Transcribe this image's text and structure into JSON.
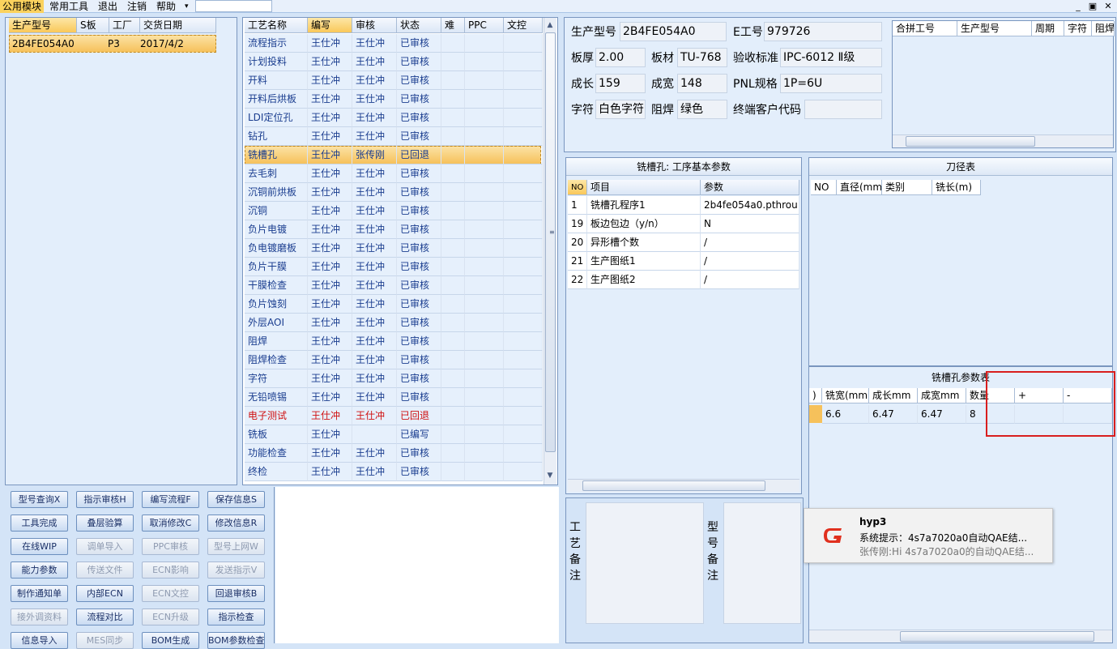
{
  "menu": {
    "items": [
      "公用模块",
      "常用工具",
      "退出",
      "注销",
      "帮助"
    ],
    "dropdown_arrow": "▾",
    "win_min": "_",
    "win_restore": "▣",
    "win_close": "✕"
  },
  "orders": {
    "headers": [
      "生产型号",
      "S板",
      "工厂",
      "交货日期"
    ],
    "rows": [
      {
        "model": "2B4FE054A0",
        "s": "",
        "factory": "P3",
        "date": "2017/4/2"
      }
    ]
  },
  "process": {
    "headers": [
      "工艺名称",
      "编写",
      "审核",
      "状态",
      "难",
      "PPC",
      "文控"
    ],
    "rows": [
      {
        "name": "流程指示",
        "writer": "王仕冲",
        "reviewer": "王仕冲",
        "status": "已审核"
      },
      {
        "name": "计划投料",
        "writer": "王仕冲",
        "reviewer": "王仕冲",
        "status": "已审核"
      },
      {
        "name": "开料",
        "writer": "王仕冲",
        "reviewer": "王仕冲",
        "status": "已审核"
      },
      {
        "name": "开料后烘板",
        "writer": "王仕冲",
        "reviewer": "王仕冲",
        "status": "已审核"
      },
      {
        "name": "LDI定位孔",
        "writer": "王仕冲",
        "reviewer": "王仕冲",
        "status": "已审核"
      },
      {
        "name": "钻孔",
        "writer": "王仕冲",
        "reviewer": "王仕冲",
        "status": "已审核"
      },
      {
        "name": "铣槽孔",
        "writer": "王仕冲",
        "reviewer": "张传刚",
        "status": "已回退"
      },
      {
        "name": "去毛刺",
        "writer": "王仕冲",
        "reviewer": "王仕冲",
        "status": "已审核"
      },
      {
        "name": "沉铜前烘板",
        "writer": "王仕冲",
        "reviewer": "王仕冲",
        "status": "已审核"
      },
      {
        "name": "沉铜",
        "writer": "王仕冲",
        "reviewer": "王仕冲",
        "status": "已审核"
      },
      {
        "name": "负片电镀",
        "writer": "王仕冲",
        "reviewer": "王仕冲",
        "status": "已审核"
      },
      {
        "name": "负电镀磨板",
        "writer": "王仕冲",
        "reviewer": "王仕冲",
        "status": "已审核"
      },
      {
        "name": "负片干膜",
        "writer": "王仕冲",
        "reviewer": "王仕冲",
        "status": "已审核"
      },
      {
        "name": "干膜检查",
        "writer": "王仕冲",
        "reviewer": "王仕冲",
        "status": "已审核"
      },
      {
        "name": "负片蚀刻",
        "writer": "王仕冲",
        "reviewer": "王仕冲",
        "status": "已审核"
      },
      {
        "name": "外层AOI",
        "writer": "王仕冲",
        "reviewer": "王仕冲",
        "status": "已审核"
      },
      {
        "name": "阻焊",
        "writer": "王仕冲",
        "reviewer": "王仕冲",
        "status": "已审核"
      },
      {
        "name": "阻焊检查",
        "writer": "王仕冲",
        "reviewer": "王仕冲",
        "status": "已审核"
      },
      {
        "name": "字符",
        "writer": "王仕冲",
        "reviewer": "王仕冲",
        "status": "已审核"
      },
      {
        "name": "无铅喷锡",
        "writer": "王仕冲",
        "reviewer": "王仕冲",
        "status": "已审核"
      },
      {
        "name": "电子测试",
        "writer": "王仕冲",
        "reviewer": "王仕冲",
        "status": "已回退"
      },
      {
        "name": "铣板",
        "writer": "王仕冲",
        "reviewer": "",
        "status": "已编写"
      },
      {
        "name": "功能检查",
        "writer": "王仕冲",
        "reviewer": "王仕冲",
        "status": "已审核"
      },
      {
        "name": "终检",
        "writer": "王仕冲",
        "reviewer": "王仕冲",
        "status": "已审核"
      }
    ],
    "scroll_up": "▲",
    "scroll_down": "▼",
    "grip": "≡"
  },
  "buttons": [
    [
      "型号查询X",
      "指示审核H",
      "编写流程F",
      "保存信息S"
    ],
    [
      "工具完成",
      "叠层验算",
      "取消修改C",
      "修改信息R"
    ],
    [
      "在线WIP",
      "调单导入",
      "PPC审核",
      "型号上网W"
    ],
    [
      "能力参数",
      "传送文件",
      "ECN影响",
      "发送指示V"
    ],
    [
      "制作通知单",
      "内部ECN",
      "ECN文控",
      "回退审核B"
    ],
    [
      "接外调资料",
      "流程对比",
      "ECN升级",
      "指示检查"
    ],
    [
      "信息导入",
      "MES同步",
      "BOM生成",
      "BOM参数检查"
    ]
  ],
  "info": {
    "model_label": "生产型号",
    "model": "2B4FE054A0",
    "eno_label": "E工号",
    "eno": "979726",
    "thick_label": "板厚",
    "thick": "2.00",
    "mat_label": "板材",
    "mat": "TU-768",
    "std_label": "验收标准",
    "std": "IPC-6012 Ⅱ级",
    "len_label": "成长",
    "len": "159",
    "wid_label": "成宽",
    "wid": "148",
    "pnl_label": "PNL规格",
    "pnl": "1P=6U",
    "char_label": "字符",
    "char": "白色字符",
    "mask_label": "阻焊",
    "mask": "绿色",
    "cust_label": "终端客户代码",
    "cust": ""
  },
  "merge": {
    "headers": [
      "合拼工号",
      "生产型号",
      "周期",
      "字符",
      "阻焊"
    ]
  },
  "params": {
    "title": "铣槽孔: 工序基本参数",
    "headers": [
      "NO",
      "项目",
      "参数"
    ],
    "rows": [
      {
        "no": "1",
        "item": "铣槽孔程序1",
        "val": "2b4fe054a0.pthrou"
      },
      {
        "no": "19",
        "item": "板边包边（y/n）",
        "val": "N"
      },
      {
        "no": "20",
        "item": "异形槽个数",
        "val": "/"
      },
      {
        "no": "21",
        "item": "生产图纸1",
        "val": "/"
      },
      {
        "no": "22",
        "item": "生产图纸2",
        "val": "/"
      }
    ]
  },
  "tools": {
    "title": "刀径表",
    "headers": [
      "NO",
      "直径(mm)",
      "类别",
      "铣长(m)"
    ]
  },
  "slot": {
    "title": "铣槽孔参数表",
    "headers": [
      ")",
      "铣宽(mm)",
      "成长mm",
      "成宽mm",
      "数量",
      "+",
      "-"
    ],
    "rows": [
      {
        "width": "6.6",
        "len": "6.47",
        "wid": "6.47",
        "qty": "8"
      }
    ]
  },
  "remarks": {
    "process_label": "工艺备注",
    "model_label": "型号备注"
  },
  "notify": {
    "app": "hyp3",
    "line1": "系统提示：4s7a7020a0自动QAE结...",
    "line2": "张传刚:Hi 4s7a7020a0的自动QAE结..."
  },
  "colors": {
    "accent": "#f6c15b",
    "link": "#1a3d8f",
    "error": "#d01010",
    "highlight_box": "#d81e1e",
    "logo": "#e0301e"
  }
}
